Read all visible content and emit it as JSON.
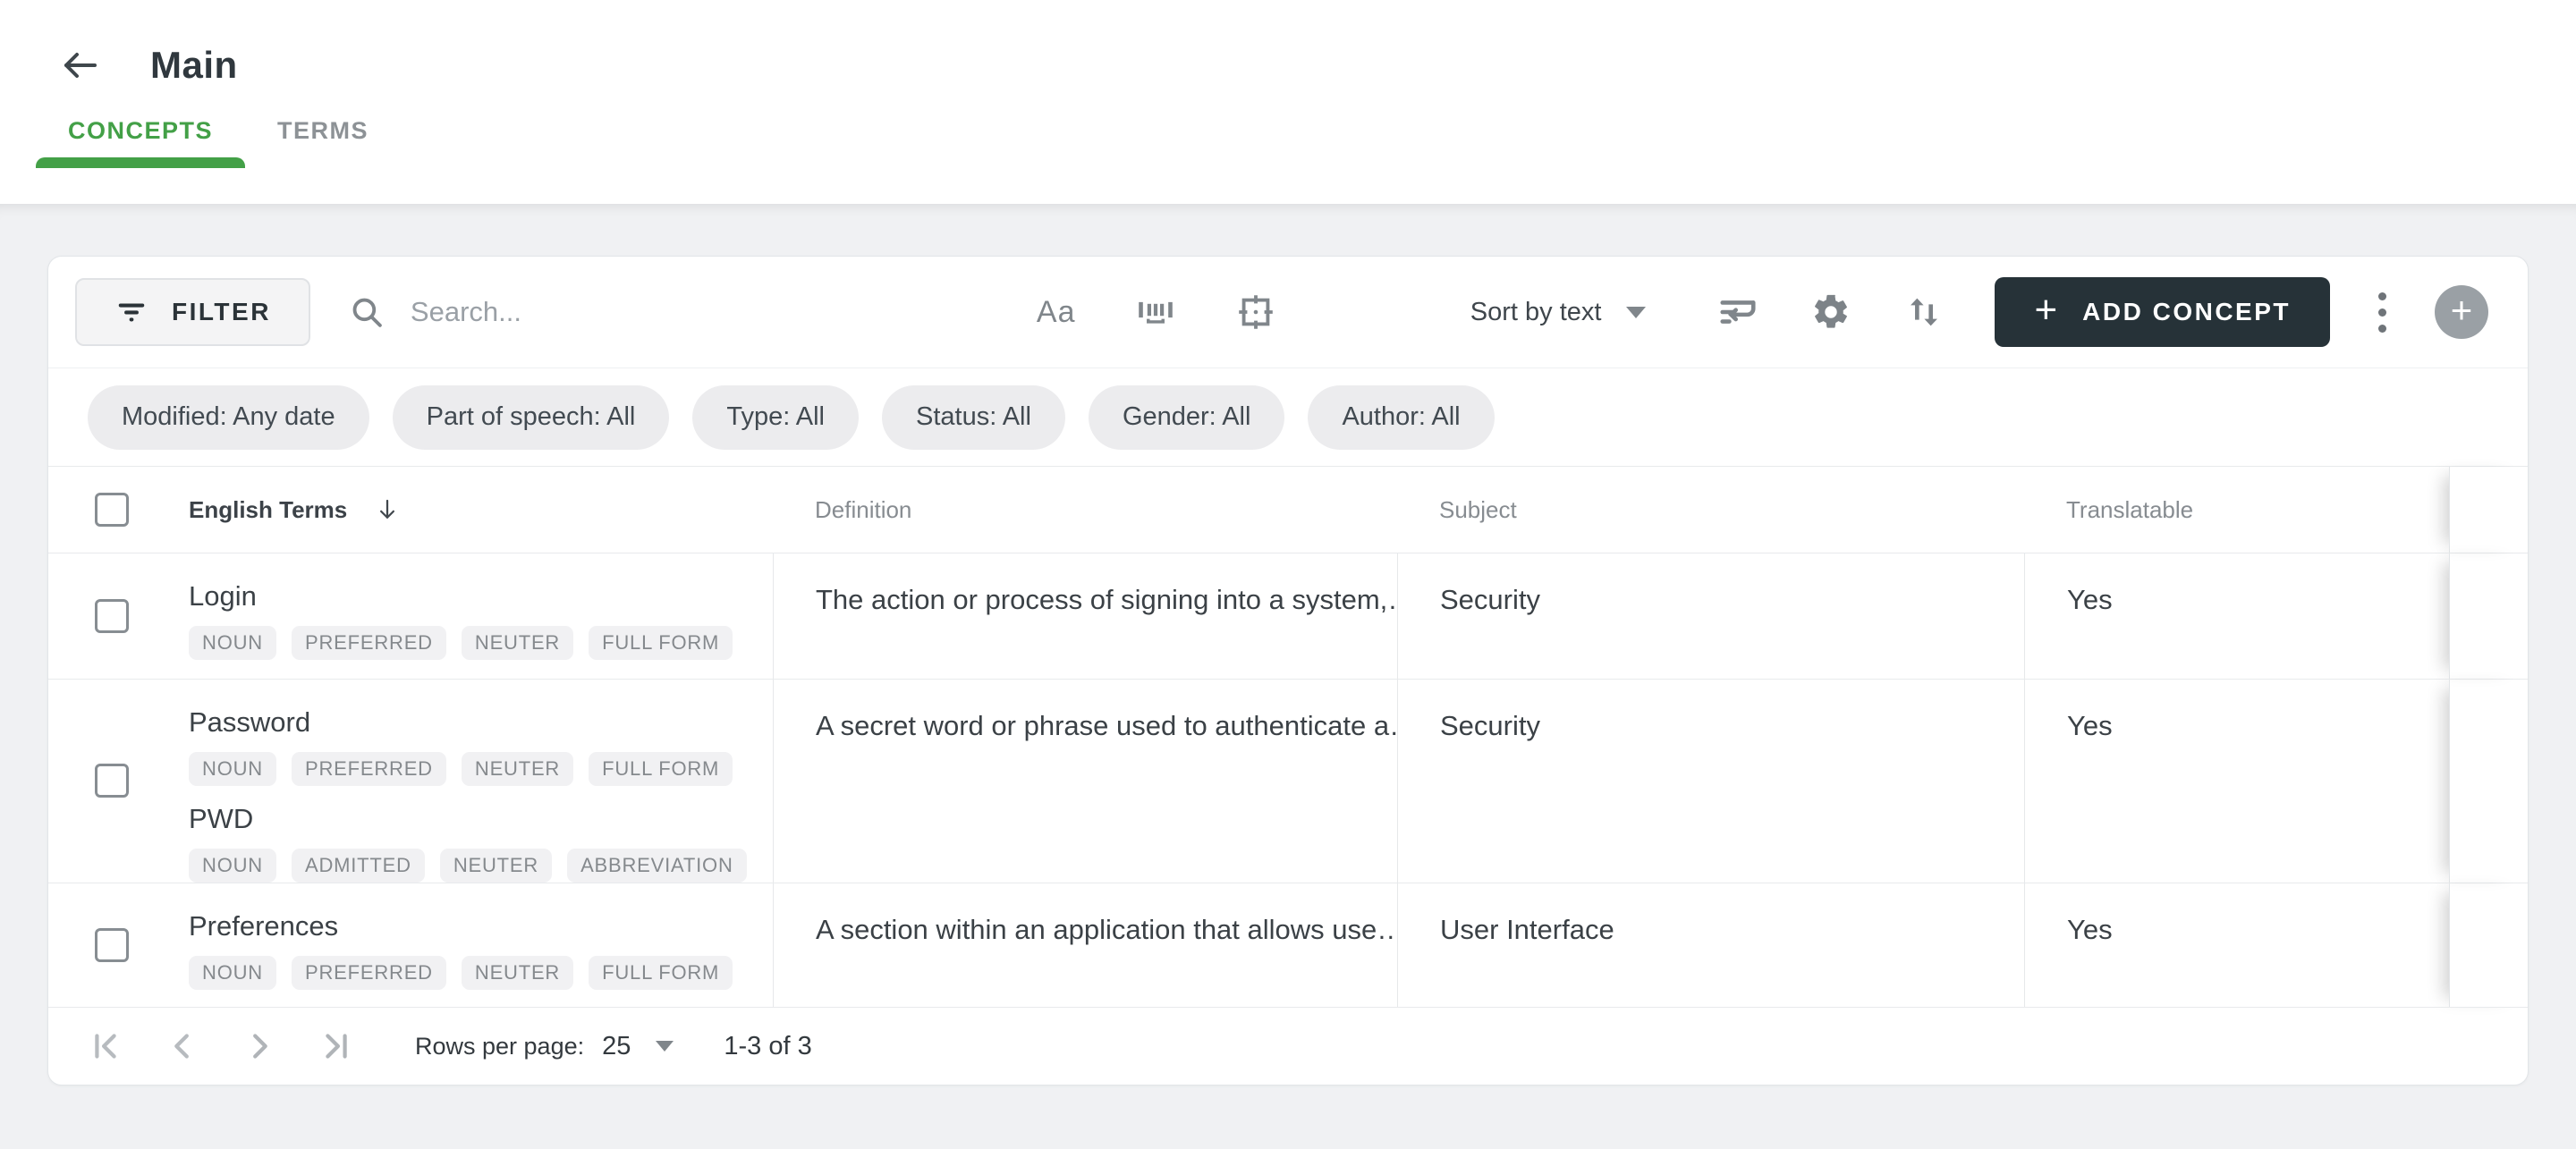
{
  "header": {
    "title": "Main"
  },
  "tabs": [
    {
      "label": "CONCEPTS",
      "active": true
    },
    {
      "label": "TERMS",
      "active": false
    }
  ],
  "toolbar": {
    "filter_label": "FILTER",
    "search_placeholder": "Search...",
    "match_case_label": "Aa",
    "sort_label": "Sort by text",
    "add_label": "ADD CONCEPT",
    "add_plus": "+",
    "fab_plus": "+"
  },
  "filters": [
    "Modified: Any date",
    "Part of speech: All",
    "Type: All",
    "Status: All",
    "Gender: All",
    "Author: All"
  ],
  "table": {
    "columns": [
      "English Terms",
      "Definition",
      "Subject",
      "Translatable"
    ],
    "rows": [
      {
        "terms": [
          {
            "text": "Login",
            "tags": [
              "NOUN",
              "PREFERRED",
              "NEUTER",
              "FULL FORM"
            ]
          }
        ],
        "definition": "The action or process of signing into a system,…",
        "subject": "Security",
        "translatable": "Yes"
      },
      {
        "terms": [
          {
            "text": "Password",
            "tags": [
              "NOUN",
              "PREFERRED",
              "NEUTER",
              "FULL FORM"
            ]
          },
          {
            "text": "PWD",
            "tags": [
              "NOUN",
              "ADMITTED",
              "NEUTER",
              "ABBREVIATION"
            ]
          }
        ],
        "definition": "A secret word or phrase used to authenticate a…",
        "subject": "Security",
        "translatable": "Yes"
      },
      {
        "terms": [
          {
            "text": "Preferences",
            "tags": [
              "NOUN",
              "PREFERRED",
              "NEUTER",
              "FULL FORM"
            ]
          }
        ],
        "definition": "A section within an application that allows use…",
        "subject": "User Interface",
        "translatable": "Yes"
      }
    ]
  },
  "pagination": {
    "rows_per_page_label": "Rows per page:",
    "rows_per_page_value": "25",
    "range": "1-3 of 3"
  },
  "icons": {
    "back": "arrow-left",
    "filter": "filter-lines",
    "search": "magnifier",
    "match_case": "Aa-text",
    "whole_word": "barcode-underline",
    "focus_frame": "focus-target-frame",
    "wrap": "wrap-text-arrow",
    "settings": "gear",
    "sort_order": "swap-vertical-arrows",
    "more": "kebab-vertical-dots",
    "sort_desc": "arrow-down",
    "pager": [
      "first-page",
      "chevron-left",
      "chevron-right",
      "last-page"
    ]
  },
  "colors": {
    "accent_green": "#43a047",
    "dark_button": "#263238",
    "page_bg": "#f0f1f3",
    "chip_bg": "#ececee",
    "tag_bg": "#f1f1f3",
    "muted_text": "#878c91",
    "body_text": "#3b4146"
  }
}
